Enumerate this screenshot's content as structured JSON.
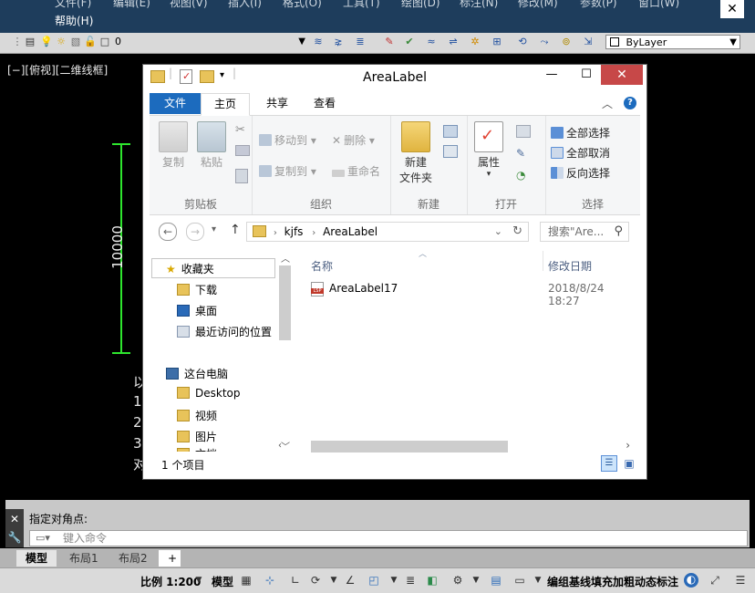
{
  "cad": {
    "menu_row1": [
      "文件(F)",
      "编辑(E)",
      "视图(V)",
      "插入(I)",
      "格式(O)",
      "工具(T)",
      "绘图(D)",
      "标注(N)",
      "修改(M)",
      "参数(P)",
      "窗口(W)"
    ],
    "menu_help": "帮助(H)",
    "close_glyph": "✕",
    "layer_value": "0",
    "linetype_value": "ByLayer",
    "viewport_label": "[−][俯视][二维线框]",
    "dimension_text": "10000",
    "cad_text_fragments": [
      "以",
      "1.",
      "2.",
      "3.",
      "对"
    ],
    "command_history": "指定对角点:",
    "command_placeholder": "键入命令",
    "layout_tabs": [
      "模型",
      "布局1",
      "布局2"
    ],
    "add_tab_glyph": "+",
    "status_scale": "比例 1:200",
    "status_model": "模型",
    "status_right": "编组基线填充加粗动态标注"
  },
  "explorer": {
    "title": "AreaLabel",
    "min_glyph": "—",
    "max_glyph": "☐",
    "close_glyph": "✕",
    "tabs": [
      "文件",
      "主页",
      "共享",
      "查看"
    ],
    "ribbon": {
      "clipboard": {
        "label": "剪贴板",
        "copy": "复制",
        "paste": "粘贴"
      },
      "organize": {
        "label": "组织",
        "move_to": "移动到",
        "copy_to": "复制到",
        "delete": "删除",
        "rename": "重命名"
      },
      "new": {
        "label": "新建",
        "new_folder_line1": "新建",
        "new_folder_line2": "文件夹"
      },
      "open": {
        "label": "打开",
        "properties": "属性"
      },
      "select": {
        "label": "选择",
        "select_all": "全部选择",
        "select_none": "全部取消",
        "invert": "反向选择"
      }
    },
    "breadcrumb": [
      "kjfs",
      "AreaLabel"
    ],
    "search_placeholder": "搜索\"Are...",
    "nav": {
      "favorites": "收藏夹",
      "downloads": "下载",
      "desktop": "桌面",
      "recent": "最近访问的位置",
      "this_pc": "这台电脑",
      "pc_desktop": "Desktop",
      "videos": "视频",
      "pictures": "图片",
      "docs_partial": "文档"
    },
    "columns": {
      "name": "名称",
      "modified": "修改日期"
    },
    "files": [
      {
        "name": "AreaLabel17",
        "modified": "2018/8/24 18:27",
        "badge": "LSP"
      }
    ],
    "status": "1 个项目"
  },
  "colors": {
    "accent": "#1c6bbe",
    "dimension_green": "#2ee62e",
    "cad_bg": "#000000"
  }
}
